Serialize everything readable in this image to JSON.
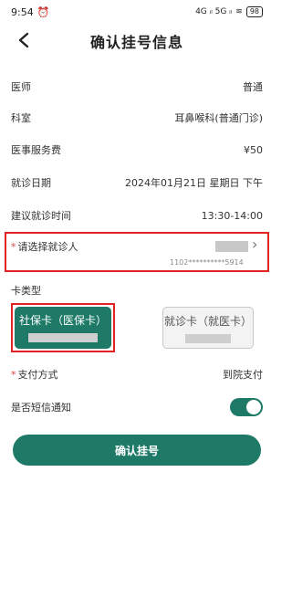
{
  "status_bar": {
    "time": "9:54",
    "alarm_icon": "alarm-icon",
    "signal": "4G ᵢₗ 5G ᵢₗ",
    "battery": "98"
  },
  "header": {
    "title": "确认挂号信息",
    "back_icon": "back-chevron-icon"
  },
  "rows": [
    {
      "label": "医师",
      "value": "普通"
    },
    {
      "label": "科室",
      "value": "耳鼻喉科(普通门诊)"
    },
    {
      "label": "医事服务费",
      "value": "¥50"
    },
    {
      "label": "就诊日期",
      "value": "2024年01月21日 星期日 下午"
    },
    {
      "label": "建议就诊时间",
      "value": "13:30-14:00"
    }
  ],
  "patient": {
    "required_mark": "*",
    "label": "请选择就诊人",
    "id_masked": "1102**********5914"
  },
  "card_type": {
    "label": "卡类型",
    "options": [
      {
        "label": "社保卡（医保卡）",
        "selected": true
      },
      {
        "label": "就诊卡（就医卡）",
        "selected": false
      }
    ]
  },
  "payment": {
    "required_mark": "*",
    "label": "支付方式",
    "value": "到院支付"
  },
  "sms": {
    "label": "是否短信通知",
    "enabled": true
  },
  "actions": {
    "confirm_label": "确认挂号"
  },
  "colors": {
    "primary": "#1e7a66",
    "highlight": "#e02424"
  }
}
